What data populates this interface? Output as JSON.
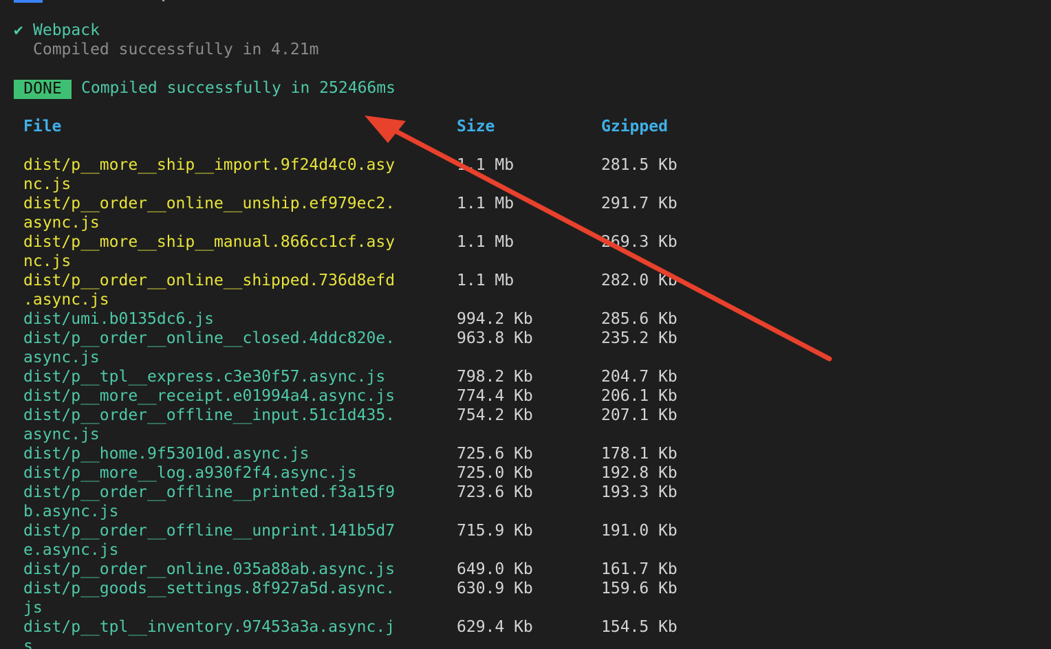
{
  "terminal": {
    "check_glyph": "✔",
    "webpack_label": "Webpack",
    "compiled_sub": "Compiled successfully in 4.21m",
    "done_badge": "DONE",
    "done_message": "Compiled successfully in 252466ms"
  },
  "table": {
    "headers": {
      "file": "File",
      "size": "Size",
      "gzipped": "Gzipped"
    },
    "rows": [
      {
        "lines": [
          "dist/p__more__ship__import.9f24d4c0.asy",
          "nc.js"
        ],
        "size": "1.1 Mb",
        "gzipped": "281.5 Kb",
        "status": "big"
      },
      {
        "lines": [
          "dist/p__order__online__unship.ef979ec2.",
          "async.js"
        ],
        "size": "1.1 Mb",
        "gzipped": "291.7 Kb",
        "status": "big"
      },
      {
        "lines": [
          "dist/p__more__ship__manual.866cc1cf.asy",
          "nc.js"
        ],
        "size": "1.1 Mb",
        "gzipped": "269.3 Kb",
        "status": "big"
      },
      {
        "lines": [
          "dist/p__order__online__shipped.736d8efd",
          ".async.js"
        ],
        "size": "1.1 Mb",
        "gzipped": "282.0 Kb",
        "status": "big"
      },
      {
        "lines": [
          "dist/umi.b0135dc6.js"
        ],
        "size": "994.2 Kb",
        "gzipped": "285.6 Kb",
        "status": "ok"
      },
      {
        "lines": [
          "dist/p__order__online__closed.4ddc820e.",
          "async.js"
        ],
        "size": "963.8 Kb",
        "gzipped": "235.2 Kb",
        "status": "ok"
      },
      {
        "lines": [
          "dist/p__tpl__express.c3e30f57.async.js"
        ],
        "size": "798.2 Kb",
        "gzipped": "204.7 Kb",
        "status": "ok"
      },
      {
        "lines": [
          "dist/p__more__receipt.e01994a4.async.js"
        ],
        "size": "774.4 Kb",
        "gzipped": "206.1 Kb",
        "status": "ok"
      },
      {
        "lines": [
          "dist/p__order__offline__input.51c1d435.",
          "async.js"
        ],
        "size": "754.2 Kb",
        "gzipped": "207.1 Kb",
        "status": "ok"
      },
      {
        "lines": [
          "dist/p__home.9f53010d.async.js"
        ],
        "size": "725.6 Kb",
        "gzipped": "178.1 Kb",
        "status": "ok"
      },
      {
        "lines": [
          "dist/p__more__log.a930f2f4.async.js"
        ],
        "size": "725.0 Kb",
        "gzipped": "192.8 Kb",
        "status": "ok"
      },
      {
        "lines": [
          "dist/p__order__offline__printed.f3a15f9",
          "b.async.js"
        ],
        "size": "723.6 Kb",
        "gzipped": "193.3 Kb",
        "status": "ok"
      },
      {
        "lines": [
          "dist/p__order__offline__unprint.141b5d7",
          "e.async.js"
        ],
        "size": "715.9 Kb",
        "gzipped": "191.0 Kb",
        "status": "ok"
      },
      {
        "lines": [
          "dist/p__order__online.035a88ab.async.js"
        ],
        "size": "649.0 Kb",
        "gzipped": "161.7 Kb",
        "status": "ok"
      },
      {
        "lines": [
          "dist/p__goods__settings.8f927a5d.async.",
          "js"
        ],
        "size": "630.9 Kb",
        "gzipped": "159.6 Kb",
        "status": "ok"
      },
      {
        "lines": [
          "dist/p__tpl__inventory.97453a3a.async.j",
          "s"
        ],
        "size": "629.4 Kb",
        "gzipped": "154.5 Kb",
        "status": "ok"
      }
    ]
  },
  "colors": {
    "background": "#1e1e1e",
    "header": "#3fb0e8",
    "big_file": "#e8e43a",
    "ok_file": "#4ec9a8",
    "done_badge": "#3fbf73",
    "arrow": "#e8412c"
  },
  "annotation": {
    "icon": "arrow-icon"
  }
}
